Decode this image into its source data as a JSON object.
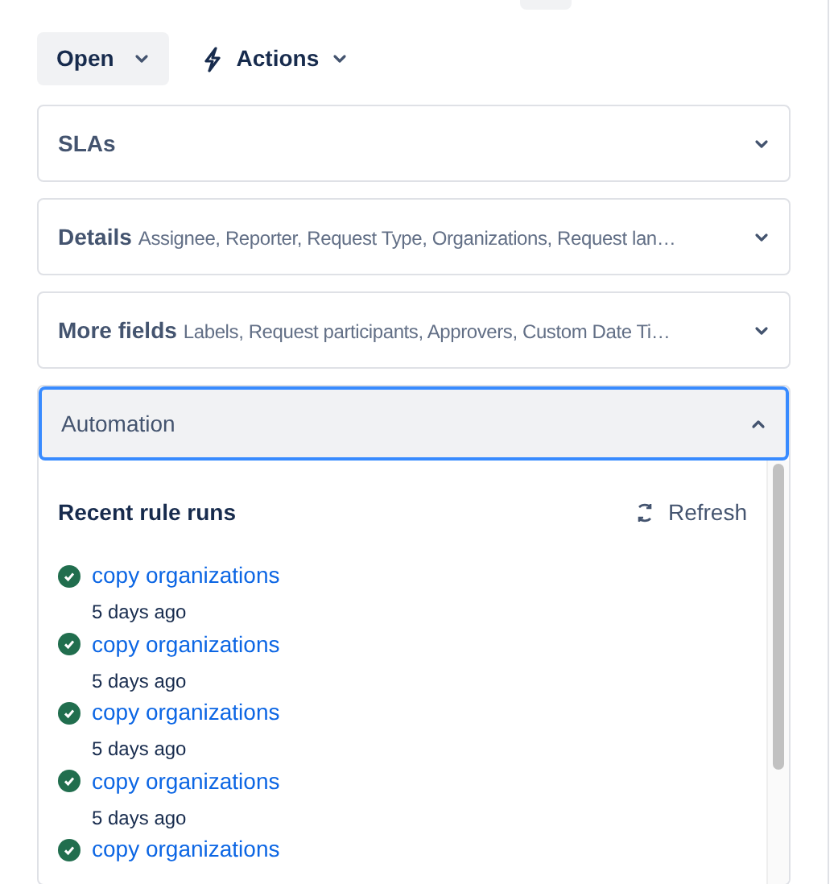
{
  "toolbar": {
    "status_button": "Open",
    "actions_button": "Actions"
  },
  "sections": [
    {
      "title": "SLAs",
      "expanded": false
    },
    {
      "title": "Details",
      "summary": "Assignee, Reporter, Request Type, Organizations, Request lan…",
      "expanded": false
    },
    {
      "title": "More fields",
      "summary": "Labels, Request participants, Approvers, Custom Date Ti…",
      "expanded": false
    },
    {
      "title": "Automation",
      "expanded": true
    }
  ],
  "automation": {
    "heading": "Recent rule runs",
    "refresh": "Refresh",
    "runs": [
      {
        "rule": "copy organizations",
        "time": "5 days ago",
        "color": "#216e4e"
      },
      {
        "rule": "copy organizations",
        "time": "5 days ago",
        "color": "#216e4e"
      },
      {
        "rule": "copy organizations",
        "time": "5 days ago",
        "color": "#216e4e"
      },
      {
        "rule": "copy organizations",
        "time": "5 days ago",
        "color": "#216e4e"
      },
      {
        "rule": "copy organizations",
        "color": "#216e4e"
      }
    ]
  }
}
